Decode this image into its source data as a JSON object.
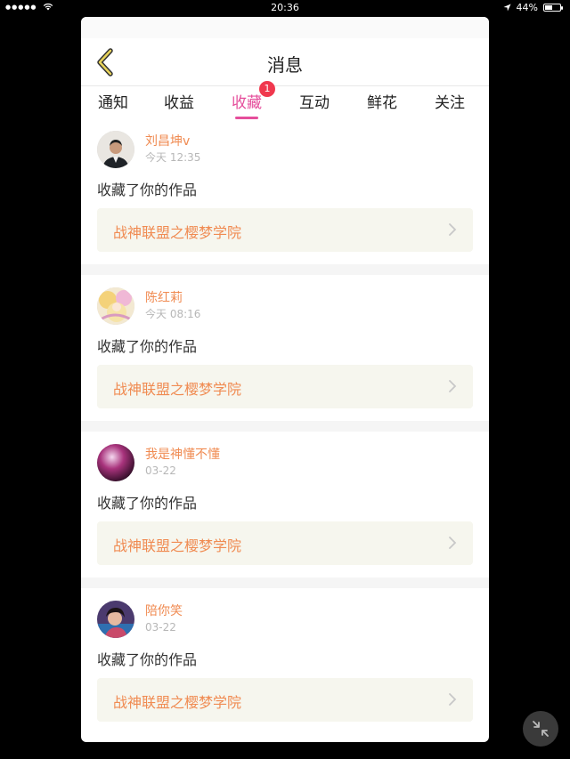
{
  "status_bar": {
    "time": "20:36",
    "battery_text": "44%",
    "battery_level": 0.44
  },
  "nav": {
    "title": "消息",
    "back_icon": "chevron-left-icon"
  },
  "tabs": [
    {
      "label": "通知",
      "active": false
    },
    {
      "label": "收益",
      "active": false
    },
    {
      "label": "收藏",
      "active": true,
      "badge": "1"
    },
    {
      "label": "互动",
      "active": false
    },
    {
      "label": "鲜花",
      "active": false
    },
    {
      "label": "关注",
      "active": false
    }
  ],
  "messages": [
    {
      "username": "刘昌坤v",
      "time": "今天 12:35",
      "action": "收藏了你的作品",
      "work_title": "战神联盟之樱梦学院"
    },
    {
      "username": "陈红莉",
      "time": "今天 08:16",
      "action": "收藏了你的作品",
      "work_title": "战神联盟之樱梦学院"
    },
    {
      "username": "我是神懂不懂",
      "time": "03-22",
      "action": "收藏了你的作品",
      "work_title": "战神联盟之樱梦学院"
    },
    {
      "username": "陪你笑",
      "time": "03-22",
      "action": "收藏了你的作品",
      "work_title": "战神联盟之樱梦学院"
    }
  ],
  "colors": {
    "accent_pink": "#e54e9b",
    "username_orange": "#f08b52",
    "badge_red": "#f0384e"
  }
}
